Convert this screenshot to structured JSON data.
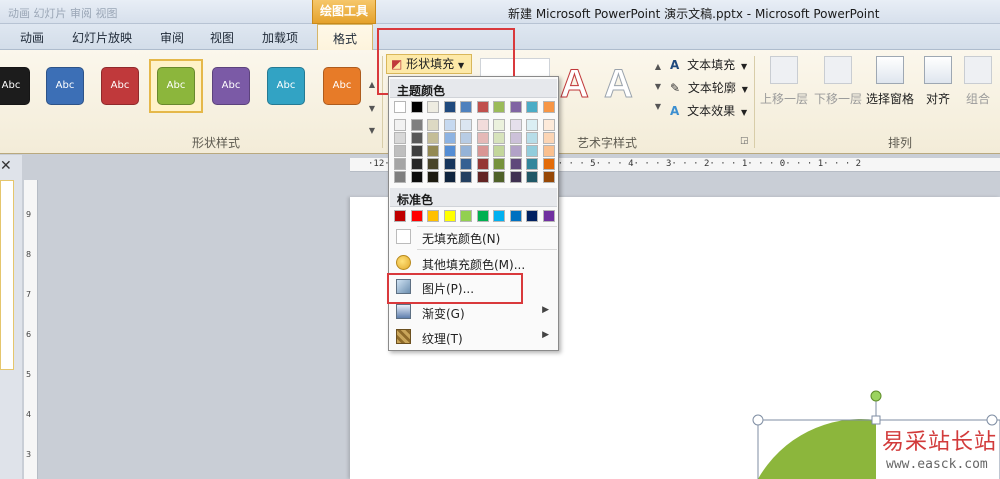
{
  "titlebar": {
    "ghost_text": "动画  幻灯片  审阅  视图",
    "context_tab": "绘图工具",
    "window_title": "新建 Microsoft PowerPoint 演示文稿.pptx - Microsoft PowerPoint"
  },
  "tabs": [
    {
      "label": "动画"
    },
    {
      "label": "幻灯片放映"
    },
    {
      "label": "审阅"
    },
    {
      "label": "视图"
    },
    {
      "label": "加载项"
    },
    {
      "label": "格式"
    }
  ],
  "shape_styles": {
    "group_label": "形状样式",
    "thumbs": [
      {
        "label": "Abc",
        "color": "#1c1c1c"
      },
      {
        "label": "Abc",
        "color": "#3c6fb6"
      },
      {
        "label": "Abc",
        "color": "#c0393b"
      },
      {
        "label": "Abc",
        "color": "#8cb63c"
      },
      {
        "label": "Abc",
        "color": "#7b5aa6"
      },
      {
        "label": "Abc",
        "color": "#32a3c4"
      },
      {
        "label": "Abc",
        "color": "#e77b28"
      }
    ],
    "selected_index": 3,
    "fill_button": "形状填充"
  },
  "wordart": {
    "group_label": "艺术字样式",
    "letter": "A",
    "text_fill": "文本填充",
    "text_outline": "文本轮廓",
    "text_effects": "文本效果"
  },
  "arrange": {
    "group_label": "排列",
    "bring_forward": "上移一层",
    "send_backward": "下移一层",
    "selection_pane": "选择窗格",
    "align": "对齐",
    "group": "组合"
  },
  "rulers": {
    "horizontal": "·12· · · · · · · · · · · · 7· · · 6· · · 5· · · 4· · · 3· · · 2· · · 1· · · 0· · · 1· · · 2",
    "vertical": [
      "9",
      "8",
      "7",
      "6",
      "5",
      "4",
      "3"
    ]
  },
  "menu": {
    "theme_header": "主题颜色",
    "standard_header": "标准色",
    "theme_top_row": [
      "#ffffff",
      "#000000",
      "#eeece1",
      "#1f497d",
      "#4f81bd",
      "#c0504d",
      "#9bbb59",
      "#8064a2",
      "#4bacc6",
      "#f79646"
    ],
    "theme_shades": [
      [
        "#f2f2f2",
        "#7f7f7f",
        "#ddd9c3",
        "#c6d9f0",
        "#dbe5f1",
        "#f2dcdb",
        "#ebf1dd",
        "#e5e0ec",
        "#dbeef3",
        "#fdeada"
      ],
      [
        "#d8d8d8",
        "#595959",
        "#c4bd97",
        "#8db3e2",
        "#b8cce4",
        "#e5b9b7",
        "#d7e3bc",
        "#ccc1d9",
        "#b7dde8",
        "#fbd5b5"
      ],
      [
        "#bfbfbf",
        "#3f3f3f",
        "#938953",
        "#548dd4",
        "#95b3d7",
        "#d99694",
        "#c3d69b",
        "#b2a2c7",
        "#92cddc",
        "#fac08f"
      ],
      [
        "#a5a5a5",
        "#262626",
        "#494429",
        "#17365d",
        "#366092",
        "#953734",
        "#76923c",
        "#5f497a",
        "#31859b",
        "#e36c09"
      ],
      [
        "#7f7f7f",
        "#0c0c0c",
        "#1d1b10",
        "#0f243e",
        "#244061",
        "#632423",
        "#4f6128",
        "#3f3151",
        "#205867",
        "#974806"
      ]
    ],
    "standard_colors": [
      "#c00000",
      "#ff0000",
      "#ffc000",
      "#ffff00",
      "#92d050",
      "#00b050",
      "#00b0f0",
      "#0070c0",
      "#002060",
      "#7030a0"
    ],
    "no_fill": "无填充颜色(N)",
    "more_colors": "其他填充颜色(M)...",
    "picture": "图片(P)...",
    "gradient": "渐变(G)",
    "texture": "纹理(T)"
  },
  "watermark": {
    "cn": "易采站长站",
    "url": "www.easck.com"
  },
  "colors": {
    "highlight_red": "#d9393c",
    "shape_green": "#8cb63c"
  }
}
